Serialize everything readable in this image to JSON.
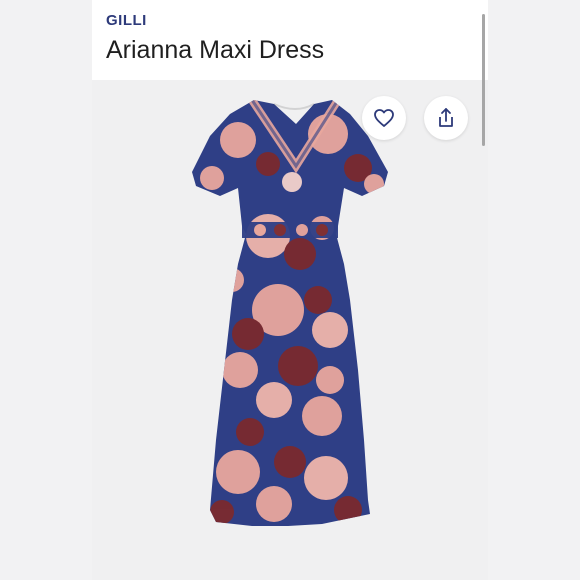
{
  "product": {
    "brand": "GILLI",
    "name": "Arianna Maxi Dress"
  },
  "actions": {
    "favorite_icon": "heart-icon",
    "share_icon": "share-icon"
  },
  "colors": {
    "brand_text": "#2d3a7a",
    "dress_base": "#2f3f86",
    "flower_pink": "#e9a79d",
    "flower_burgundy": "#7b2a2e"
  }
}
